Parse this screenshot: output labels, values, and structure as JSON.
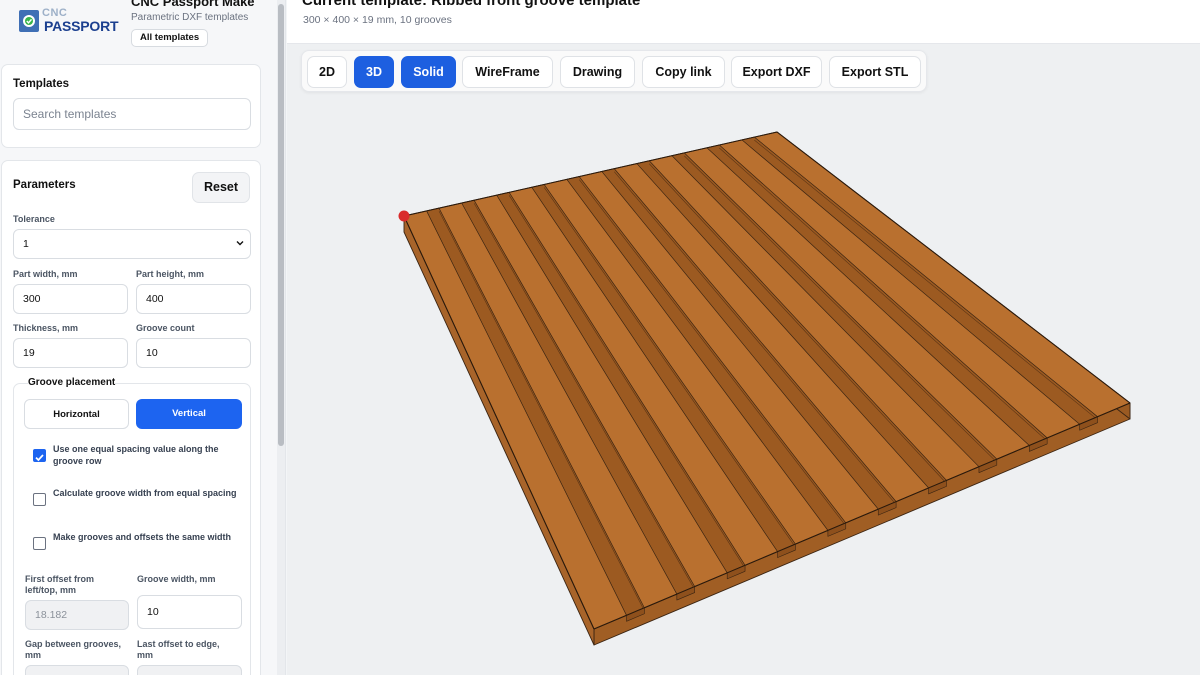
{
  "brand": {
    "logo_top": "CNC",
    "logo_bottom": "PASSPORT",
    "title": "CNC Passport Make",
    "subtitle": "Parametric DXF templates",
    "all_templates": "All templates"
  },
  "templates_panel": {
    "title": "Templates",
    "search_placeholder": "Search templates"
  },
  "parameters": {
    "title": "Parameters",
    "reset": "Reset",
    "tolerance_label": "Tolerance",
    "tolerance_value": "1",
    "width_label": "Part width, mm",
    "width_value": "300",
    "height_label": "Part height, mm",
    "height_value": "400",
    "thickness_label": "Thickness, mm",
    "thickness_value": "19",
    "groove_count_label": "Groove count",
    "groove_count_value": "10",
    "groove_placement": {
      "title": "Groove placement",
      "horizontal": "Horizontal",
      "vertical": "Vertical",
      "selected": "Vertical",
      "options": [
        {
          "label": "Use one equal spacing value along the groove row",
          "checked": true
        },
        {
          "label": "Calculate groove width from equal spacing",
          "checked": false
        },
        {
          "label": "Make grooves and offsets the same width",
          "checked": false
        }
      ],
      "first_offset_label": "First offset from left/top, mm",
      "first_offset_value": "18.182",
      "groove_width_label": "Groove width, mm",
      "groove_width_value": "10",
      "gap_label": "Gap between grooves, mm",
      "last_offset_label": "Last offset to edge, mm"
    }
  },
  "header": {
    "title": "Current template: Ribbed front groove template",
    "subtitle": "300 × 400 × 19 mm, 10 grooves"
  },
  "toolbar": {
    "buttons": [
      {
        "label": "2D",
        "active": false
      },
      {
        "label": "3D",
        "active": true
      },
      {
        "label": "Solid",
        "active": true
      },
      {
        "label": "WireFrame",
        "active": false
      },
      {
        "label": "Drawing",
        "active": false
      },
      {
        "label": "Copy link",
        "active": false
      },
      {
        "label": "Export DXF",
        "active": false
      },
      {
        "label": "Export STL",
        "active": false
      }
    ]
  },
  "colors": {
    "accent": "#1d5fe0",
    "wood_top": "#b9702f",
    "wood_side": "#a05e24",
    "origin_marker": "#d92b2b"
  }
}
